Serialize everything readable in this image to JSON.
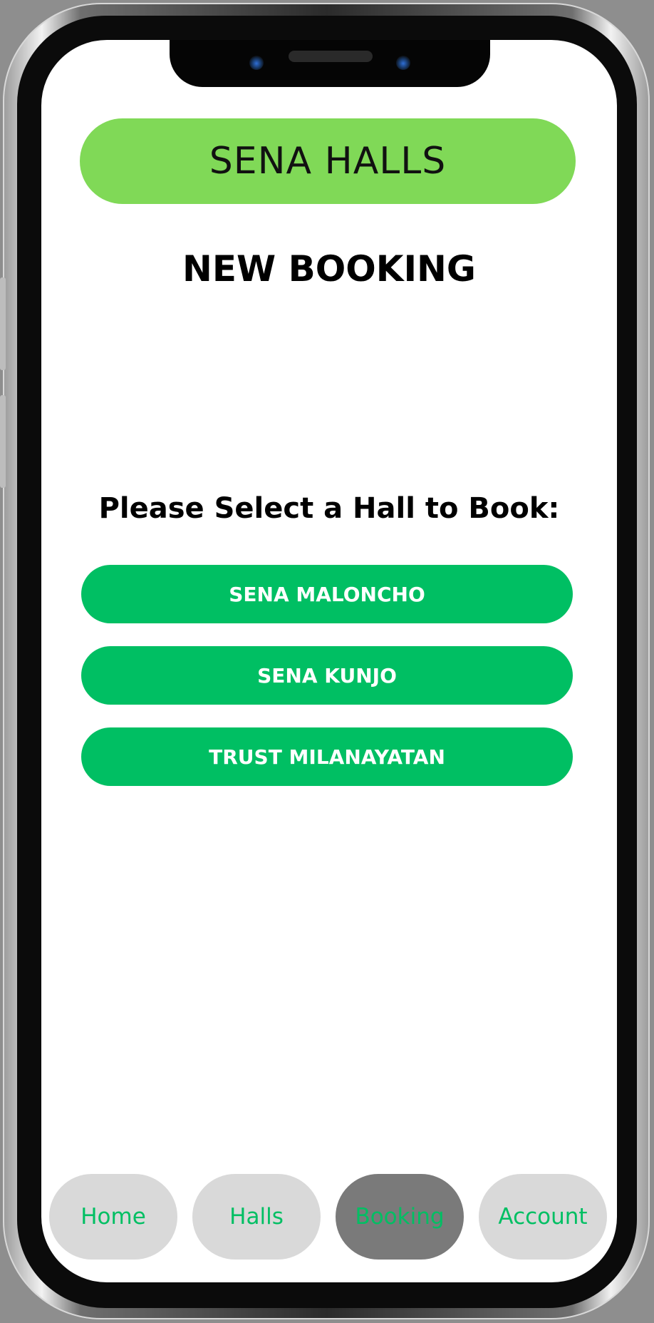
{
  "app": {
    "title": "SENA HALLS"
  },
  "page": {
    "title": "NEW BOOKING",
    "prompt": "Please Select a Hall to Book:"
  },
  "halls": [
    {
      "label": "SENA MALONCHO"
    },
    {
      "label": "SENA KUNJO"
    },
    {
      "label": "TRUST MILANAYATAN"
    }
  ],
  "nav": {
    "items": [
      {
        "label": "Home"
      },
      {
        "label": "Halls"
      },
      {
        "label": "Booking",
        "active": true
      },
      {
        "label": "Account"
      }
    ]
  },
  "colors": {
    "header_bg": "#80d957",
    "button_bg": "#00bf63",
    "button_text": "#ffffff",
    "nav_bg": "#d9d9d9",
    "nav_active_bg": "#7a7a7a",
    "nav_text": "#00bf63"
  }
}
